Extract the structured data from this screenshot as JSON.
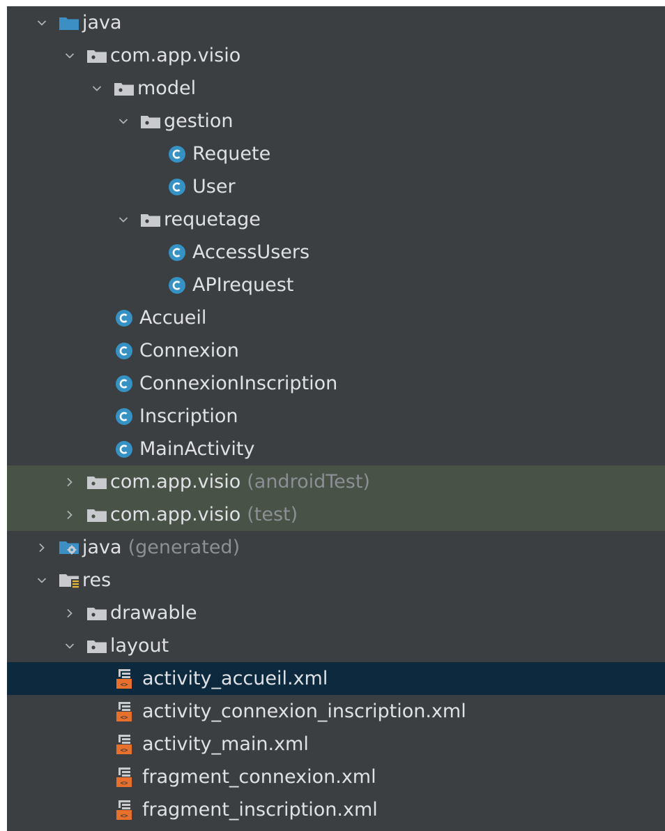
{
  "tree": {
    "java": {
      "label": "java"
    },
    "com_app_visio": {
      "label": "com.app.visio"
    },
    "model": {
      "label": "model"
    },
    "gestion": {
      "label": "gestion"
    },
    "requete": {
      "label": "Requete"
    },
    "user": {
      "label": "User"
    },
    "requetage": {
      "label": "requetage"
    },
    "access_users": {
      "label": "AccessUsers"
    },
    "api_request": {
      "label": "APIrequest"
    },
    "accueil": {
      "label": "Accueil"
    },
    "connexion": {
      "label": "Connexion"
    },
    "connexion_inscription": {
      "label": "ConnexionInscription"
    },
    "inscription": {
      "label": "Inscription"
    },
    "main_activity": {
      "label": "MainActivity"
    },
    "android_test": {
      "label": "com.app.visio",
      "suffix": "(androidTest)"
    },
    "test": {
      "label": "com.app.visio",
      "suffix": "(test)"
    },
    "java_generated": {
      "label": "java",
      "suffix": "(generated)"
    },
    "res": {
      "label": "res"
    },
    "drawable": {
      "label": "drawable"
    },
    "layout": {
      "label": "layout"
    },
    "activity_accueil_xml": {
      "label": "activity_accueil.xml"
    },
    "activity_connexion_inscription_xml": {
      "label": "activity_connexion_inscription.xml"
    },
    "activity_main_xml": {
      "label": "activity_main.xml"
    },
    "fragment_connexion_xml": {
      "label": "fragment_connexion.xml"
    },
    "fragment_inscription_xml": {
      "label": "fragment_inscription.xml"
    }
  },
  "icons": {
    "expanded": "chevron-down-icon",
    "collapsed": "chevron-right-icon",
    "source_folder": "source-folder-icon",
    "package": "package-folder-icon",
    "class": "java-class-icon",
    "generated": "generated-folder-icon",
    "resources": "resources-folder-icon",
    "layout_file": "layout-xml-file-icon"
  },
  "colors": {
    "panel_background": "#3c3f41",
    "text": "#dfe1e5",
    "suffix_text": "#8c8f93",
    "test_highlight": "#485247",
    "selected_row": "#0d293e",
    "class_icon": "#3592c4",
    "source_folder_icon": "#3b8fc4",
    "xml_icon": "#e8702a"
  }
}
